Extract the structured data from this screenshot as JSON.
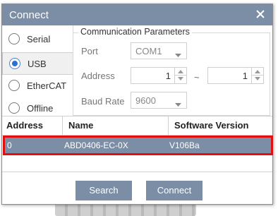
{
  "window": {
    "title": "Connect",
    "close_icon": "close-icon"
  },
  "connection_types": [
    {
      "label": "Serial",
      "selected": false
    },
    {
      "label": "USB",
      "selected": true
    },
    {
      "label": "EtherCAT",
      "selected": false
    },
    {
      "label": "Offline",
      "selected": false
    }
  ],
  "parameters": {
    "group_title": "Communication Parameters",
    "port_label": "Port",
    "port_value": "COM1",
    "address_label": "Address",
    "address_from": "1",
    "address_separator": "~",
    "address_to": "1",
    "baud_label": "Baud Rate",
    "baud_value": "9600"
  },
  "table": {
    "columns": [
      "Address",
      "Name",
      "Software Version"
    ],
    "rows": [
      {
        "address": "0",
        "name": "ABD0406-EC-0X",
        "software_version": "V106Ba",
        "selected": true
      }
    ]
  },
  "buttons": {
    "search": "Search",
    "connect": "Connect"
  },
  "colors": {
    "accent": "#7b8ea6",
    "highlight_outline": "#e01010",
    "radio_selected": "#2d6fd2"
  }
}
